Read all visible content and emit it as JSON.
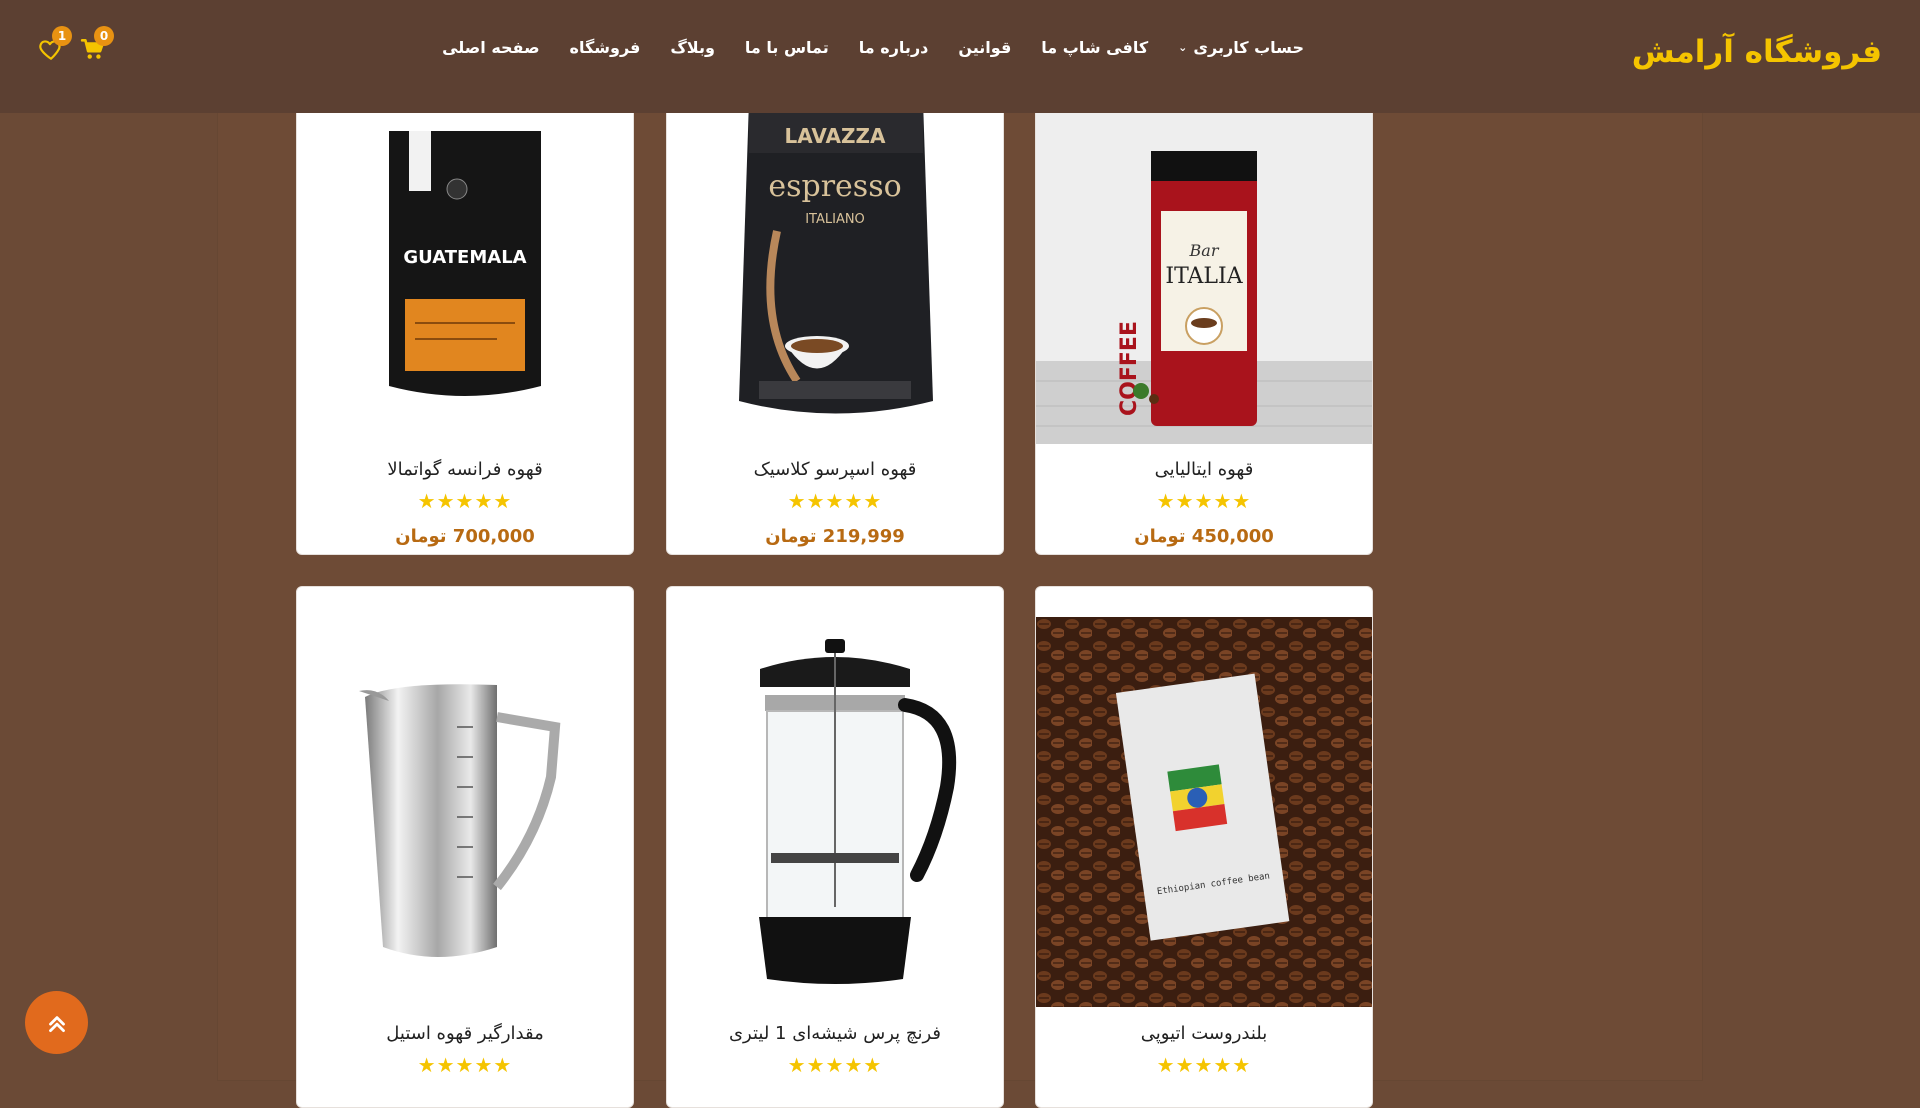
{
  "header": {
    "logo": "فروشگاه آرامش",
    "nav": [
      "صفحه اصلی",
      "فروشگاه",
      "وبلاگ",
      "تماس با ما",
      "درباره ما",
      "قوانین",
      "کافی شاپ ما",
      "حساب کاربری"
    ],
    "cart_count": "0",
    "wishlist_count": "1"
  },
  "products": [
    {
      "title": "قهوه ایتالیایی",
      "stars": "★★★★★",
      "price": "450,000 تومان"
    },
    {
      "title": "قهوه اسپرسو کلاسیک",
      "stars": "★★★★★",
      "price": "219,999 تومان"
    },
    {
      "title": "قهوه فرانسه گواتمالا",
      "stars": "★★★★★",
      "price": "700,000 تومان"
    },
    {
      "title": "بلندروست اتیوپی",
      "stars": "★★★★★"
    },
    {
      "title": "فرنچ پرس شیشه‌ای 1 لیتری",
      "stars": "★★★★★"
    },
    {
      "title": "مقدارگیر قهوه استیل",
      "stars": "★★★★★"
    }
  ],
  "image_labels": {
    "lavazza": "LAVAZZA",
    "espresso": "espresso",
    "italiano": "ITALIANO",
    "guatemala": "GUATEMALA",
    "coffee": "COFFEE",
    "bar": "Bar",
    "italia": "ITALIA",
    "ethiopian": "Ethiopian coffee bean"
  },
  "colors": {
    "header_bg": "#5c4032",
    "logo": "#f5c400",
    "price": "#b86a12",
    "star": "#f5c400",
    "to_top": "#e16a1d"
  },
  "icons": [
    "cart-icon",
    "heart-icon",
    "chevron-down-icon",
    "double-chevron-up-icon"
  ]
}
